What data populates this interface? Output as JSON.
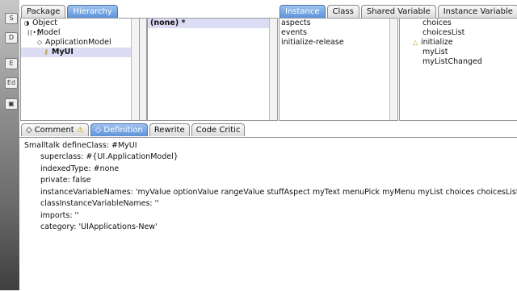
{
  "top_left_tabs": [
    {
      "label": "Package",
      "active": false
    },
    {
      "label": "Hierarchy",
      "active": true
    }
  ],
  "top_right_tabs": [
    {
      "label": "Instance",
      "active": true
    },
    {
      "label": "Class",
      "active": false
    },
    {
      "label": "Shared Variable",
      "active": false
    },
    {
      "label": "Instance Variable",
      "active": false
    }
  ],
  "class_tree": [
    {
      "label": "Object",
      "icon": "circle-icon",
      "indent": 0,
      "selected": false
    },
    {
      "label": "Model",
      "icon": "antenna-icon",
      "indent": 1,
      "selected": false
    },
    {
      "label": "ApplicationModel",
      "icon": "diamond-icon",
      "indent": 2,
      "selected": false
    },
    {
      "label": "MyUI",
      "icon": "key-icon",
      "indent": 3,
      "selected": true
    }
  ],
  "protocol_header": "(none) *",
  "protocols": [
    {
      "label": "aspects",
      "selected": false
    },
    {
      "label": "events",
      "selected": false
    },
    {
      "label": "initialize-release",
      "selected": false
    }
  ],
  "methods": [
    {
      "label": "choices",
      "marker": ""
    },
    {
      "label": "choicesList",
      "marker": ""
    },
    {
      "label": "initialize",
      "marker": "triangle"
    },
    {
      "label": "myList",
      "marker": ""
    },
    {
      "label": "myListChanged",
      "marker": ""
    }
  ],
  "bottom_tabs": [
    {
      "label": "Comment",
      "icon": "diamond-icon",
      "warn": true,
      "active": false
    },
    {
      "label": "Definition",
      "icon": "diamond-icon",
      "warn": false,
      "active": true
    },
    {
      "label": "Rewrite",
      "icon": "",
      "warn": false,
      "active": false
    },
    {
      "label": "Code Critic",
      "icon": "",
      "warn": false,
      "active": false
    }
  ],
  "definition": {
    "line1": "Smalltalk defineClass: #MyUI",
    "line2": "superclass: #{UI.ApplicationModel}",
    "line3": "indexedType: #none",
    "line4": "private: false",
    "line5": "instanceVariableNames: 'myValue optionValue rangeValue stuffAspect myText menuPick myMenu myList choices choicesList '",
    "line6": "classInstanceVariableNames: ''",
    "line7": "imports: ''",
    "line8": "category: 'UIApplications-New'"
  },
  "left_strip_glyphs": [
    "S",
    "D",
    "E",
    "Ed",
    "▣"
  ]
}
